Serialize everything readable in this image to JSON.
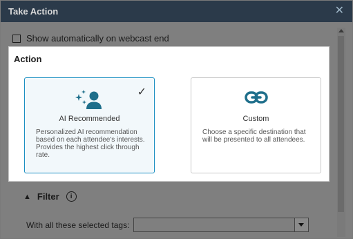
{
  "window": {
    "title": "Take Action",
    "close_icon": "close-icon"
  },
  "options": {
    "show_automatically_label": "Show automatically on webcast end",
    "show_automatically_checked": false
  },
  "action": {
    "heading": "Action",
    "cards": [
      {
        "title": "AI Recommended",
        "description": "Personalized AI recommendation based on each attendee's interests. Provides the highest click through rate.",
        "icon": "ai-person-sparkle-icon",
        "selected": true
      },
      {
        "title": "Custom",
        "description": "Choose a specific destination that will be presented to all attendees.",
        "icon": "link-icon",
        "selected": false
      }
    ]
  },
  "filter": {
    "heading": "Filter",
    "tags_label": "With all these selected tags:",
    "tags_value": ""
  },
  "colors": {
    "accent": "#1b8fc2",
    "icon_blue": "#1f6f8b",
    "titlebar": "#2b3a4a"
  }
}
